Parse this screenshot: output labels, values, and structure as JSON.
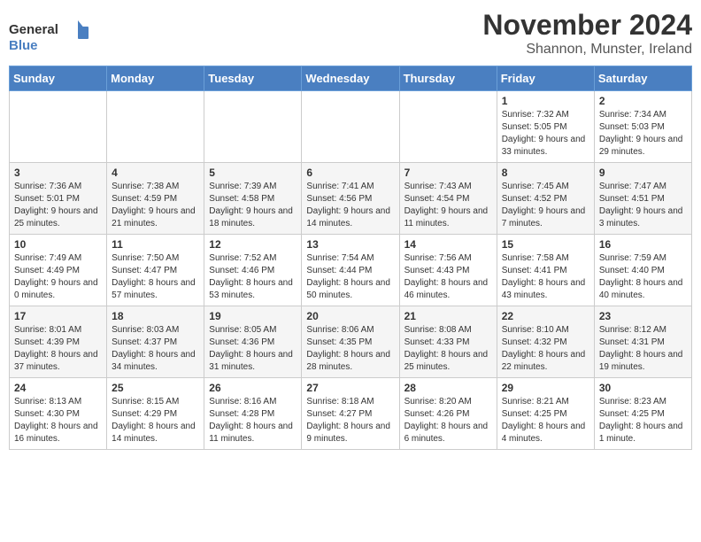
{
  "header": {
    "logo_line1": "General",
    "logo_line2": "Blue",
    "title": "November 2024",
    "subtitle": "Shannon, Munster, Ireland"
  },
  "weekdays": [
    "Sunday",
    "Monday",
    "Tuesday",
    "Wednesday",
    "Thursday",
    "Friday",
    "Saturday"
  ],
  "weeks": [
    [
      {
        "day": "",
        "info": ""
      },
      {
        "day": "",
        "info": ""
      },
      {
        "day": "",
        "info": ""
      },
      {
        "day": "",
        "info": ""
      },
      {
        "day": "",
        "info": ""
      },
      {
        "day": "1",
        "info": "Sunrise: 7:32 AM\nSunset: 5:05 PM\nDaylight: 9 hours and 33 minutes."
      },
      {
        "day": "2",
        "info": "Sunrise: 7:34 AM\nSunset: 5:03 PM\nDaylight: 9 hours and 29 minutes."
      }
    ],
    [
      {
        "day": "3",
        "info": "Sunrise: 7:36 AM\nSunset: 5:01 PM\nDaylight: 9 hours and 25 minutes."
      },
      {
        "day": "4",
        "info": "Sunrise: 7:38 AM\nSunset: 4:59 PM\nDaylight: 9 hours and 21 minutes."
      },
      {
        "day": "5",
        "info": "Sunrise: 7:39 AM\nSunset: 4:58 PM\nDaylight: 9 hours and 18 minutes."
      },
      {
        "day": "6",
        "info": "Sunrise: 7:41 AM\nSunset: 4:56 PM\nDaylight: 9 hours and 14 minutes."
      },
      {
        "day": "7",
        "info": "Sunrise: 7:43 AM\nSunset: 4:54 PM\nDaylight: 9 hours and 11 minutes."
      },
      {
        "day": "8",
        "info": "Sunrise: 7:45 AM\nSunset: 4:52 PM\nDaylight: 9 hours and 7 minutes."
      },
      {
        "day": "9",
        "info": "Sunrise: 7:47 AM\nSunset: 4:51 PM\nDaylight: 9 hours and 3 minutes."
      }
    ],
    [
      {
        "day": "10",
        "info": "Sunrise: 7:49 AM\nSunset: 4:49 PM\nDaylight: 9 hours and 0 minutes."
      },
      {
        "day": "11",
        "info": "Sunrise: 7:50 AM\nSunset: 4:47 PM\nDaylight: 8 hours and 57 minutes."
      },
      {
        "day": "12",
        "info": "Sunrise: 7:52 AM\nSunset: 4:46 PM\nDaylight: 8 hours and 53 minutes."
      },
      {
        "day": "13",
        "info": "Sunrise: 7:54 AM\nSunset: 4:44 PM\nDaylight: 8 hours and 50 minutes."
      },
      {
        "day": "14",
        "info": "Sunrise: 7:56 AM\nSunset: 4:43 PM\nDaylight: 8 hours and 46 minutes."
      },
      {
        "day": "15",
        "info": "Sunrise: 7:58 AM\nSunset: 4:41 PM\nDaylight: 8 hours and 43 minutes."
      },
      {
        "day": "16",
        "info": "Sunrise: 7:59 AM\nSunset: 4:40 PM\nDaylight: 8 hours and 40 minutes."
      }
    ],
    [
      {
        "day": "17",
        "info": "Sunrise: 8:01 AM\nSunset: 4:39 PM\nDaylight: 8 hours and 37 minutes."
      },
      {
        "day": "18",
        "info": "Sunrise: 8:03 AM\nSunset: 4:37 PM\nDaylight: 8 hours and 34 minutes."
      },
      {
        "day": "19",
        "info": "Sunrise: 8:05 AM\nSunset: 4:36 PM\nDaylight: 8 hours and 31 minutes."
      },
      {
        "day": "20",
        "info": "Sunrise: 8:06 AM\nSunset: 4:35 PM\nDaylight: 8 hours and 28 minutes."
      },
      {
        "day": "21",
        "info": "Sunrise: 8:08 AM\nSunset: 4:33 PM\nDaylight: 8 hours and 25 minutes."
      },
      {
        "day": "22",
        "info": "Sunrise: 8:10 AM\nSunset: 4:32 PM\nDaylight: 8 hours and 22 minutes."
      },
      {
        "day": "23",
        "info": "Sunrise: 8:12 AM\nSunset: 4:31 PM\nDaylight: 8 hours and 19 minutes."
      }
    ],
    [
      {
        "day": "24",
        "info": "Sunrise: 8:13 AM\nSunset: 4:30 PM\nDaylight: 8 hours and 16 minutes."
      },
      {
        "day": "25",
        "info": "Sunrise: 8:15 AM\nSunset: 4:29 PM\nDaylight: 8 hours and 14 minutes."
      },
      {
        "day": "26",
        "info": "Sunrise: 8:16 AM\nSunset: 4:28 PM\nDaylight: 8 hours and 11 minutes."
      },
      {
        "day": "27",
        "info": "Sunrise: 8:18 AM\nSunset: 4:27 PM\nDaylight: 8 hours and 9 minutes."
      },
      {
        "day": "28",
        "info": "Sunrise: 8:20 AM\nSunset: 4:26 PM\nDaylight: 8 hours and 6 minutes."
      },
      {
        "day": "29",
        "info": "Sunrise: 8:21 AM\nSunset: 4:25 PM\nDaylight: 8 hours and 4 minutes."
      },
      {
        "day": "30",
        "info": "Sunrise: 8:23 AM\nSunset: 4:25 PM\nDaylight: 8 hours and 1 minute."
      }
    ]
  ]
}
